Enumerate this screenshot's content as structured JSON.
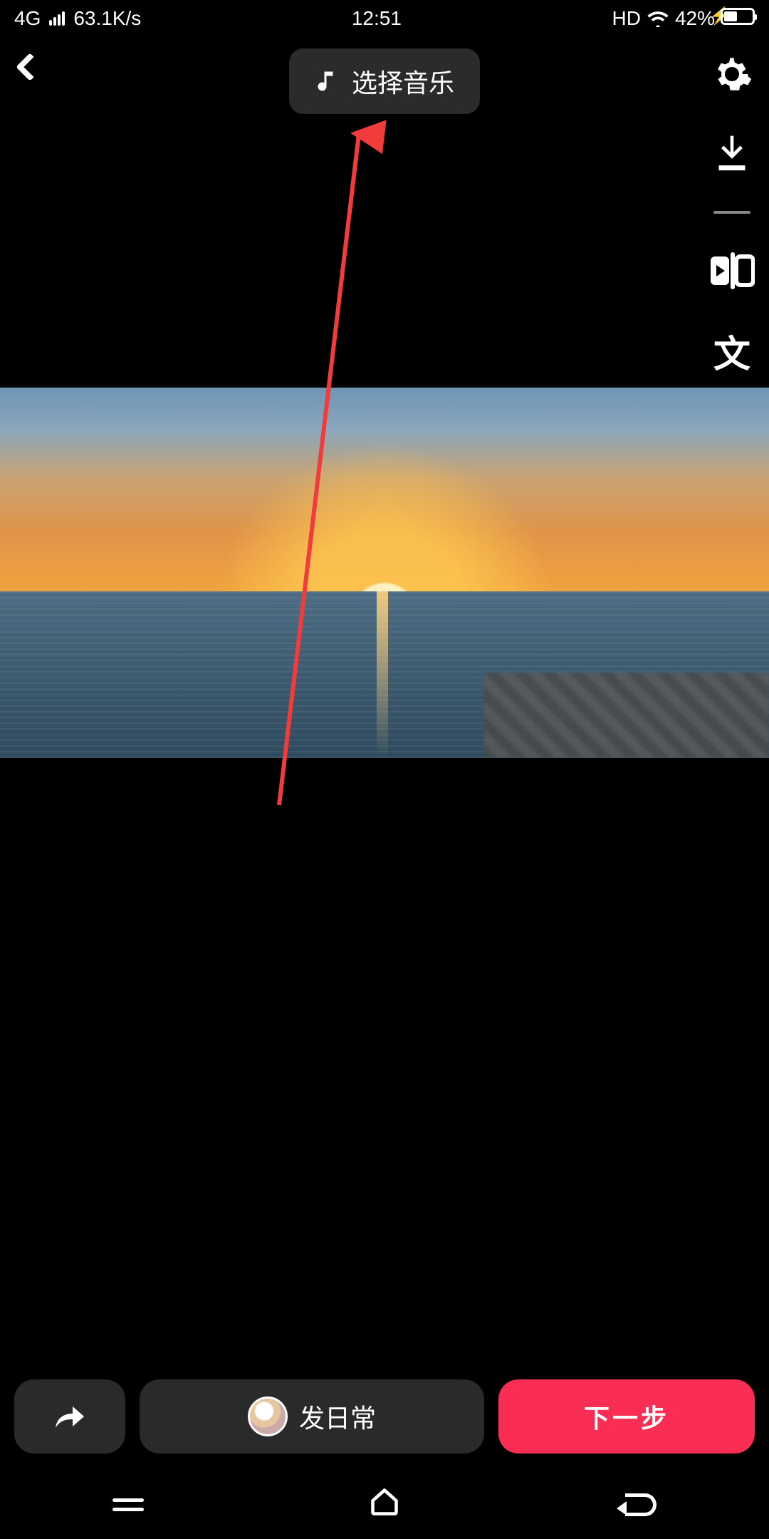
{
  "status": {
    "network": "4G",
    "speed": "63.1K/s",
    "time": "12:51",
    "hd": "HD",
    "battery_pct": "42%"
  },
  "header": {
    "music_label": "选择音乐"
  },
  "tools": {
    "text_glyph": "文"
  },
  "bottom": {
    "daily_label": "发日常",
    "next_label": "下一步"
  },
  "colors": {
    "accent": "#fa2d55",
    "arrow": "#f23b3b"
  }
}
